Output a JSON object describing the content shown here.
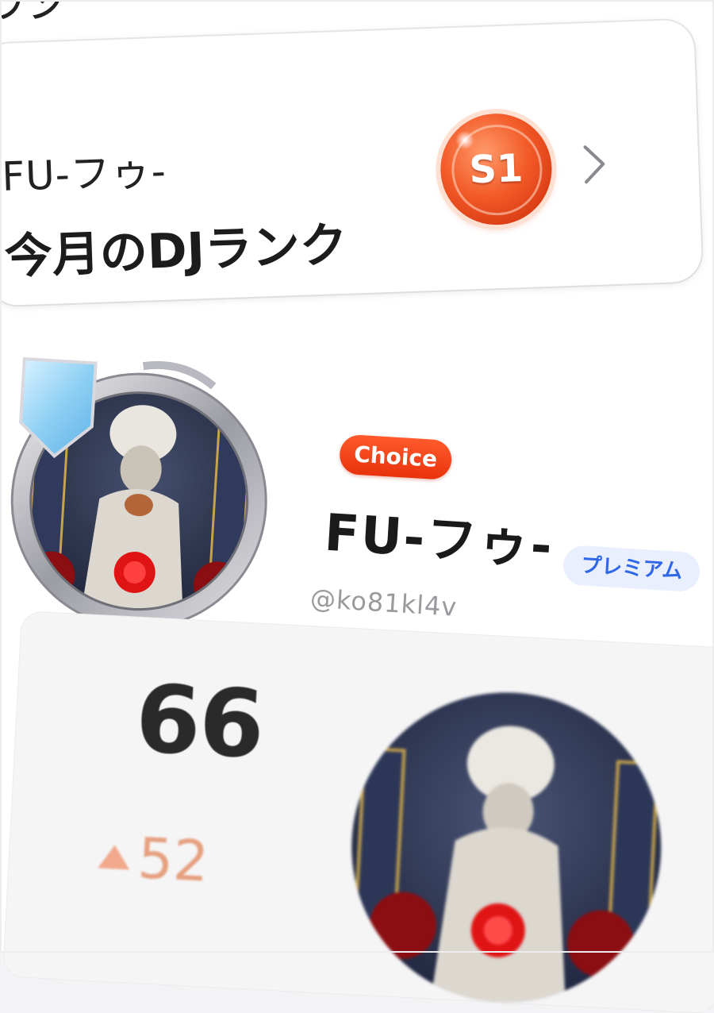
{
  "top_strip": {
    "text": "フン"
  },
  "rank_card": {
    "username": "FU-フゥ-",
    "title": "今月のDJランク",
    "badge_label": "S1",
    "chevron_icon": "chevron-right-icon",
    "badge_color": "#e8481a"
  },
  "profile": {
    "choice_label": "Choice",
    "display_name": "FU-フゥ-",
    "premium_label": "プレミアム",
    "handle": "@ko81kl4v",
    "choice_color": "#ff4a1c",
    "premium_color": "#2f67e6"
  },
  "score": {
    "value": "66",
    "change": "52",
    "change_direction": "up",
    "change_color": "#e6a07f"
  }
}
